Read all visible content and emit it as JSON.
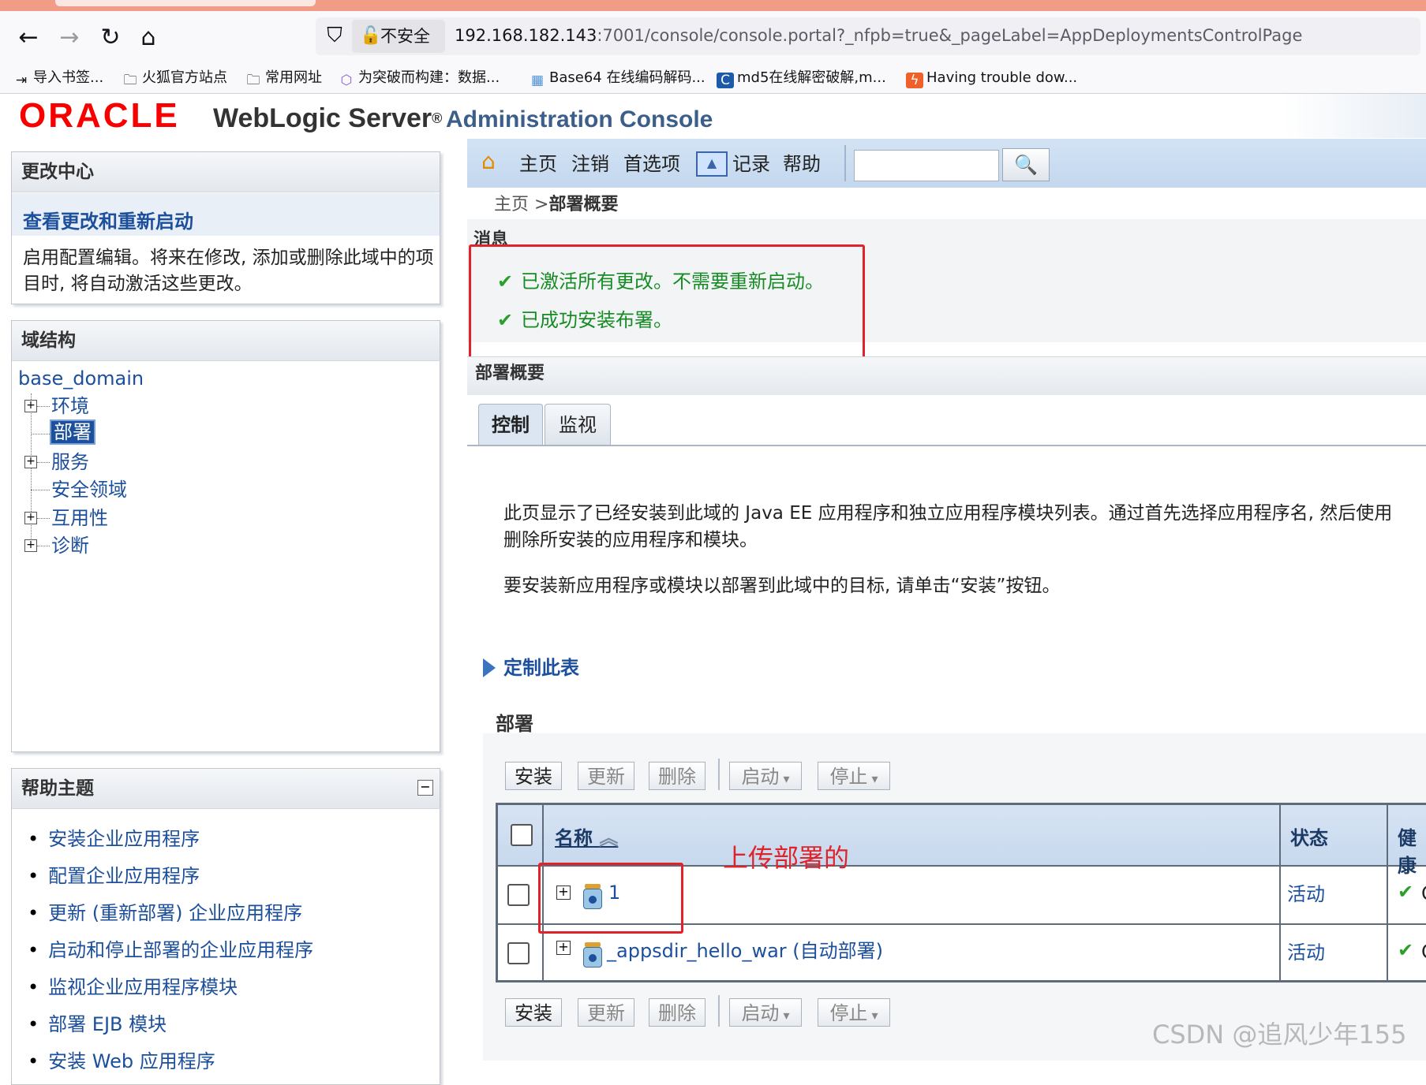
{
  "browser": {
    "insecure_label": "不安全",
    "url_host": "192.168.182.143",
    "url_rest": ":7001/console/console.portal?_nfpb=true&_pageLabel=AppDeploymentsControlPage",
    "bookmarks": [
      "导入书签...",
      "火狐官方站点",
      "常用网址",
      "为突破而构建：数据...",
      "Base64 在线编码解码...",
      "md5在线解密破解,m...",
      "Having trouble dow..."
    ]
  },
  "brand": {
    "oracle": "ORACLE",
    "product": "WebLogic Server",
    "reg": "®",
    "subtitle": "Administration Console"
  },
  "change_center": {
    "title": "更改中心",
    "link": "查看更改和重新启动",
    "description": "启用配置编辑。将来在修改, 添加或删除此域中的项目时, 将自动激活这些更改。"
  },
  "domain_structure": {
    "title": "域结构",
    "root": "base_domain",
    "items": [
      "环境",
      "部署",
      "服务",
      "安全领域",
      "互用性",
      "诊断"
    ]
  },
  "help_topics": {
    "title": "帮助主题",
    "items": [
      "安装企业应用程序",
      "配置企业应用程序",
      "更新 (重新部署) 企业应用程序",
      "启动和停止部署的企业应用程序",
      "监视企业应用程序模块",
      "部署 EJB 模块",
      "安装 Web 应用程序"
    ]
  },
  "toolbar": {
    "home": "主页",
    "logout": "注销",
    "preferences": "首选项",
    "record": "记录",
    "help": "帮助",
    "search_value": ""
  },
  "breadcrumb": {
    "home": "主页",
    "sep": " >",
    "current": "部署概要"
  },
  "messages": {
    "title": "消息",
    "lines": [
      "已激活所有更改。不需要重新启动。",
      "已成功安装布署。"
    ]
  },
  "deployments": {
    "section_title": "部署概要",
    "tabs": [
      "控制",
      "监视"
    ],
    "description_1a": "此页显示了已经安装到此域的 Java EE 应用程序和独立应用程序模块列表。通过首先选择应用程序名, 然后使用",
    "description_1b": "删除所安装的应用程序和模块。",
    "description_2": "要安装新应用程序或模块以部署到此域中的目标, 请单击“安装”按钮。",
    "customize": "定制此表",
    "table_title": "部署",
    "buttons": {
      "install": "安装",
      "update": "更新",
      "delete": "删除",
      "start": "启动",
      "stop": "停止"
    },
    "columns": [
      "名称",
      "状态",
      "健康"
    ],
    "rows": [
      {
        "name": "1",
        "state": "活动",
        "health": "O"
      },
      {
        "name": "_appsdir_hello_war (自动部署)",
        "state": "活动",
        "health": "O"
      }
    ],
    "annotation": "上传部署的"
  },
  "watermark": "CSDN @追风少年155",
  "colors": {
    "accent": "#1c4f9c",
    "success": "#178c24",
    "annotation_red": "#e0232b",
    "oracle_red": "#f80000"
  }
}
